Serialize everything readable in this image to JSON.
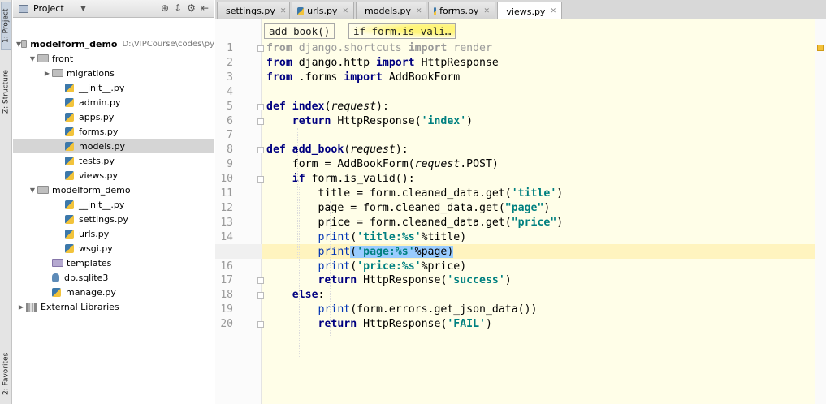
{
  "sidebar_strip": {
    "project_tab": "1: Project",
    "structure_tab": "Z: Structure",
    "favorites_tab": "2: Favorites"
  },
  "project_panel": {
    "title": "Project",
    "tree": [
      {
        "label": "modelform_demo",
        "path": "D:\\VIPCourse\\codes\\py",
        "depth": 0,
        "expanded": true,
        "kind": "project"
      },
      {
        "label": "front",
        "depth": 1,
        "expanded": true,
        "kind": "folder"
      },
      {
        "label": "migrations",
        "depth": 2,
        "expanded": false,
        "kind": "folder"
      },
      {
        "label": "__init__.py",
        "depth": 3,
        "kind": "py"
      },
      {
        "label": "admin.py",
        "depth": 3,
        "kind": "py"
      },
      {
        "label": "apps.py",
        "depth": 3,
        "kind": "py"
      },
      {
        "label": "forms.py",
        "depth": 3,
        "kind": "py"
      },
      {
        "label": "models.py",
        "depth": 3,
        "kind": "py",
        "selected": true
      },
      {
        "label": "tests.py",
        "depth": 3,
        "kind": "py"
      },
      {
        "label": "views.py",
        "depth": 3,
        "kind": "py"
      },
      {
        "label": "modelform_demo",
        "depth": 1,
        "expanded": true,
        "kind": "folder"
      },
      {
        "label": "__init__.py",
        "depth": 3,
        "kind": "py"
      },
      {
        "label": "settings.py",
        "depth": 3,
        "kind": "py"
      },
      {
        "label": "urls.py",
        "depth": 3,
        "kind": "py"
      },
      {
        "label": "wsgi.py",
        "depth": 3,
        "kind": "py"
      },
      {
        "label": "templates",
        "depth": 2,
        "kind": "folder-purple"
      },
      {
        "label": "db.sqlite3",
        "depth": 2,
        "kind": "db"
      },
      {
        "label": "manage.py",
        "depth": 2,
        "kind": "py"
      },
      {
        "label": "External Libraries",
        "depth": 0,
        "expanded": false,
        "kind": "lib"
      }
    ]
  },
  "editor_tabs": [
    {
      "label": "settings.py",
      "active": false
    },
    {
      "label": "urls.py",
      "active": false
    },
    {
      "label": "models.py",
      "active": false
    },
    {
      "label": "forms.py",
      "active": false
    },
    {
      "label": "views.py",
      "active": true
    }
  ],
  "breadcrumbs": [
    "add_book()",
    "if form.is_vali…"
  ],
  "code": {
    "current_line": 15,
    "lines": [
      "from django.shortcuts import render",
      "from django.http import HttpResponse",
      "from .forms import AddBookForm",
      "",
      "def index(request):",
      "    return HttpResponse('index')",
      "",
      "def add_book(request):",
      "    form = AddBookForm(request.POST)",
      "    if form.is_valid():",
      "        title = form.cleaned_data.get('title')",
      "        page = form.cleaned_data.get(\"page\")",
      "        price = form.cleaned_data.get(\"price\")",
      "        print('title:%s'%title)",
      "        print('page:%s'%page)",
      "        print('price:%s'%price)",
      "        return HttpResponse('success')",
      "    else:",
      "        print(form.errors.get_json_data())",
      "        return HttpResponse('FAIL')"
    ]
  },
  "colors": {
    "keyword": "#000080",
    "string": "#008080",
    "builtin": "#0033b3",
    "editor_bg": "#fffee8",
    "current_line": "#fff4bf",
    "selection_match": "#99ccff"
  }
}
